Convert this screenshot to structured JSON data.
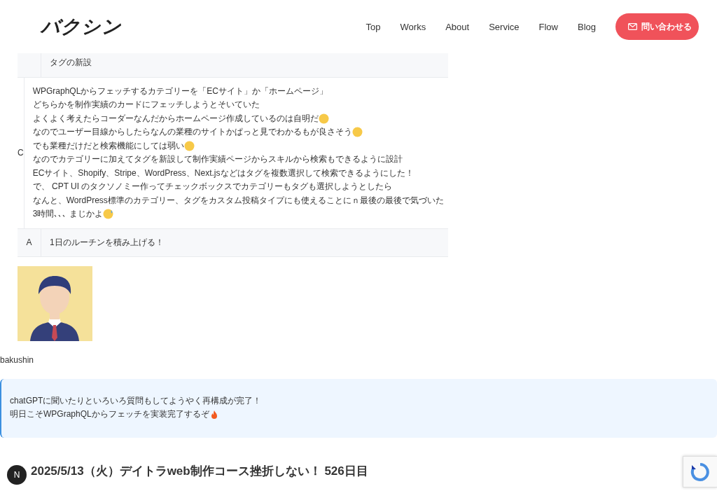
{
  "header": {
    "logo": "バクシン",
    "nav": [
      {
        "label": "Top"
      },
      {
        "label": "Works"
      },
      {
        "label": "About"
      },
      {
        "label": "Service"
      },
      {
        "label": "Flow"
      },
      {
        "label": "Blog"
      }
    ],
    "contact_button": "問い合わせる"
  },
  "table": {
    "rows": [
      {
        "label": "",
        "lines": [
          {
            "text": "タグの新設"
          }
        ]
      },
      {
        "label": "C",
        "lines": [
          {
            "text": "WPGraphQLからフェッチするカテゴリーを「ECサイト」か「ホームページ」"
          },
          {
            "text": "どちらかを制作実績のカードにフェッチしようとそいていた"
          },
          {
            "text": "よくよく考えたらコーダーなんだからホームページ作成しているのは自明だ",
            "kind": "thinking"
          },
          {
            "text": "なのでユーザー目線からしたらなんの業種のサイトかぱっと見でわかるもが良さそう",
            "kind": "thinking"
          },
          {
            "text": "でも業種だけだと検索機能にしては弱い",
            "kind": "thinking"
          },
          {
            "text": "なのでカテゴリーに加えてタグを新設して制作実績ページからスキルから検索もできるように設計"
          },
          {
            "text": "ECサイト、Shopify、Stripe、WordPress、Next.jsなどはタグを複数選択して検索できるようにした！"
          },
          {
            "text": "で、 CPT UI のタクソノミー作ってチェックボックスでカテゴリーもタグも選択しようとしたら"
          },
          {
            "text": "なんと、WordPress標準のカテゴリー、タグをカスタム投稿タイプにも使えることにｎ最後の最後で気づいた"
          },
          {
            "text": "3時間､､､ まじかよ",
            "kind": "sweat"
          }
        ]
      },
      {
        "label": "A",
        "lines": [
          {
            "text": "1日のルーチンを積み上げる！"
          }
        ]
      }
    ]
  },
  "author": {
    "name": "bakushin"
  },
  "callout": {
    "lines": [
      {
        "text": "chatGPTに聞いたりといろいろ質問もしてようやく再構成が完了！"
      },
      {
        "text": "明日こそWPGraphQLからフェッチを実装完了するぞ",
        "kind": "fire"
      }
    ]
  },
  "post_title": "2025/5/13（火）デイトラweb制作コース挫折しない！ 526日目",
  "floating_badge": "N"
}
